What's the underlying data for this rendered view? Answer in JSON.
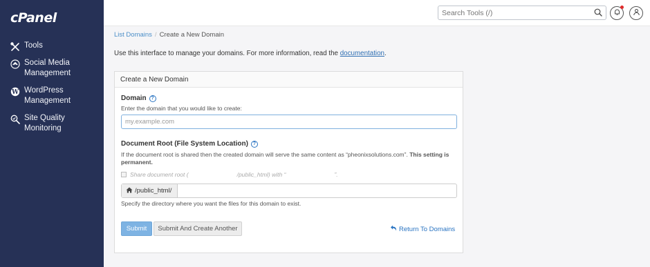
{
  "brand": {
    "logo_text": "cPanel"
  },
  "sidebar": {
    "items": [
      {
        "label": "Tools",
        "icon": "tools-icon"
      },
      {
        "label": "Social Media Management",
        "icon": "social-media-icon"
      },
      {
        "label": "WordPress Management",
        "icon": "wordpress-icon"
      },
      {
        "label": "Site Quality Monitoring",
        "icon": "site-quality-icon"
      }
    ]
  },
  "topbar": {
    "search_placeholder": "Search Tools (/)",
    "notification_dot_color": "#e02b2b"
  },
  "breadcrumb": {
    "parent": "List Domains",
    "current": "Create a New Domain"
  },
  "intro": {
    "text": "Use this interface to manage your domains. For more information, read the ",
    "link": "documentation",
    "suffix": "."
  },
  "form": {
    "panel_title": "Create a New Domain",
    "domain_label": "Domain",
    "domain_desc": "Enter the domain that you would like to create:",
    "domain_placeholder": "my.example.com",
    "docroot_label": "Document Root (File System Location)",
    "docroot_desc": "If the document root is shared then the created domain will serve the same content as “pheonixsolutions.com”. ",
    "docroot_desc_bold": "This setting is permanent.",
    "share_checkbox_prefix": "Share document root (",
    "share_checkbox_mid": "/public_html) with “",
    "share_checkbox_suffix": "”.",
    "path_prefix": "/public_html/",
    "path_value": "",
    "path_help": "Specify the directory where you want the files for this domain to exist.",
    "submit_label": "Submit",
    "submit_another_label": "Submit And Create Another",
    "return_label": "Return To Domains"
  },
  "colors": {
    "sidebar_bg": "#263156",
    "accent": "#2a74c2",
    "submit_bg": "#7eb3e3"
  }
}
